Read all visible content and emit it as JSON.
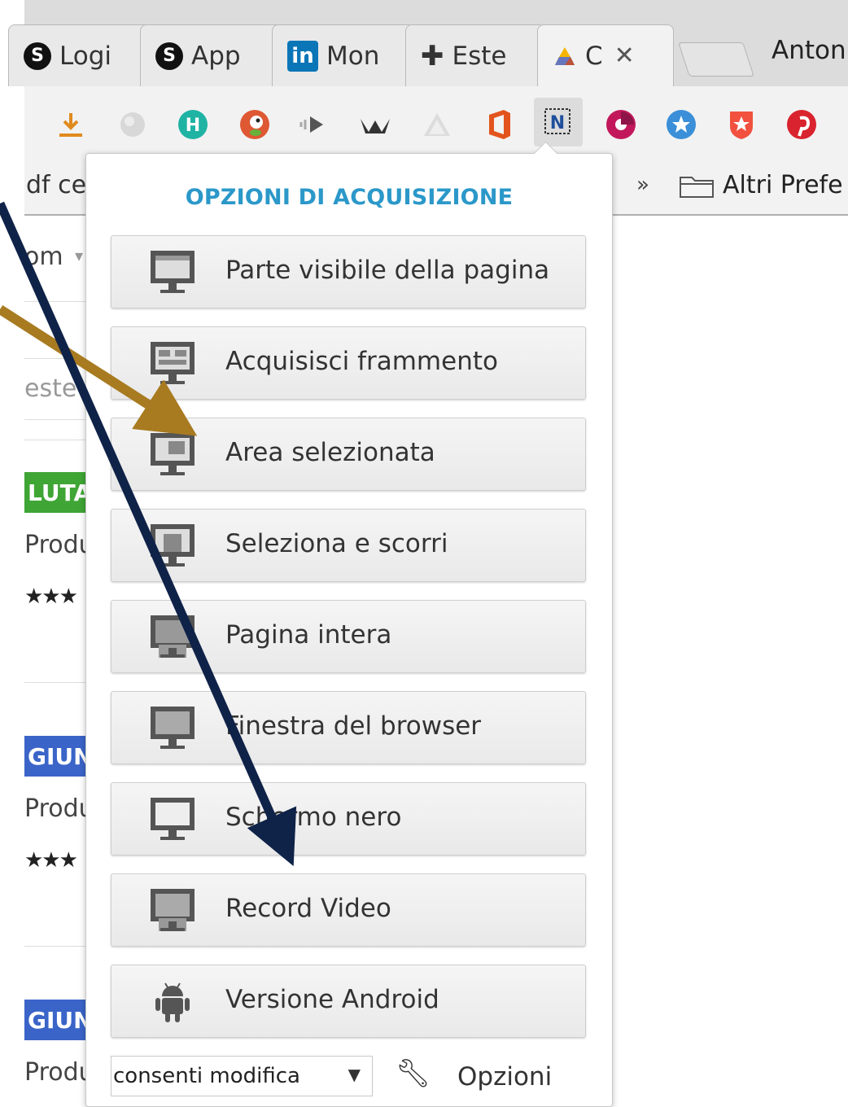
{
  "tabs": [
    {
      "label": "Logi",
      "icon": "skype-icon"
    },
    {
      "label": "App",
      "icon": "skype-icon"
    },
    {
      "label": "Mon",
      "icon": "linkedin-icon"
    },
    {
      "label": "Este",
      "icon": "puzzle-icon"
    },
    {
      "label": "C",
      "icon": "google-drive-icon",
      "active": true
    }
  ],
  "profile": {
    "name": "Antoni"
  },
  "toolbar_icons": [
    "download-icon",
    "globe-icon",
    "hunter-icon",
    "duckduckgo-icon",
    "speaker-icon",
    "crown-icon",
    "triangle-icon",
    "office-icon",
    "nimbus-capture-icon",
    "pinwheel-icon",
    "star-badge-icon",
    "shield-star-icon",
    "pinterest-icon"
  ],
  "bookmarks": {
    "partial_label": "df ce",
    "more": "»",
    "other_folder": "Altri Prefe"
  },
  "page_fragments": {
    "dropdown_text": "om",
    "search_text": "este",
    "badge1": "LUTA",
    "badge2": "GIUN",
    "badge3": "GIUN",
    "product": "Produ",
    "stars": "★★★"
  },
  "colors": {
    "badge_green": "#3fa535",
    "badge_blue": "#3a64c8",
    "title": "#2b98c9",
    "arrow_gold": "#a87b21",
    "arrow_navy": "#0f2248"
  },
  "popup": {
    "title": "OPZIONI DI ACQUISIZIONE",
    "options": [
      {
        "label": "Parte visibile della pagina",
        "icon": "monitor-visible-icon"
      },
      {
        "label": "Acquisisci frammento",
        "icon": "monitor-fragment-icon"
      },
      {
        "label": "Area selezionata",
        "icon": "monitor-area-icon"
      },
      {
        "label": "Seleziona e scorri",
        "icon": "monitor-scroll-icon"
      },
      {
        "label": "Pagina intera",
        "icon": "monitor-full-icon"
      },
      {
        "label": "Finestra del browser",
        "icon": "monitor-window-icon"
      },
      {
        "label": "Schermo nero",
        "icon": "monitor-black-icon"
      },
      {
        "label": "Record Video",
        "icon": "monitor-video-icon"
      },
      {
        "label": "Versione Android",
        "icon": "android-icon"
      }
    ],
    "mode_select": "consenti modifica",
    "options_link": "Opzioni"
  }
}
